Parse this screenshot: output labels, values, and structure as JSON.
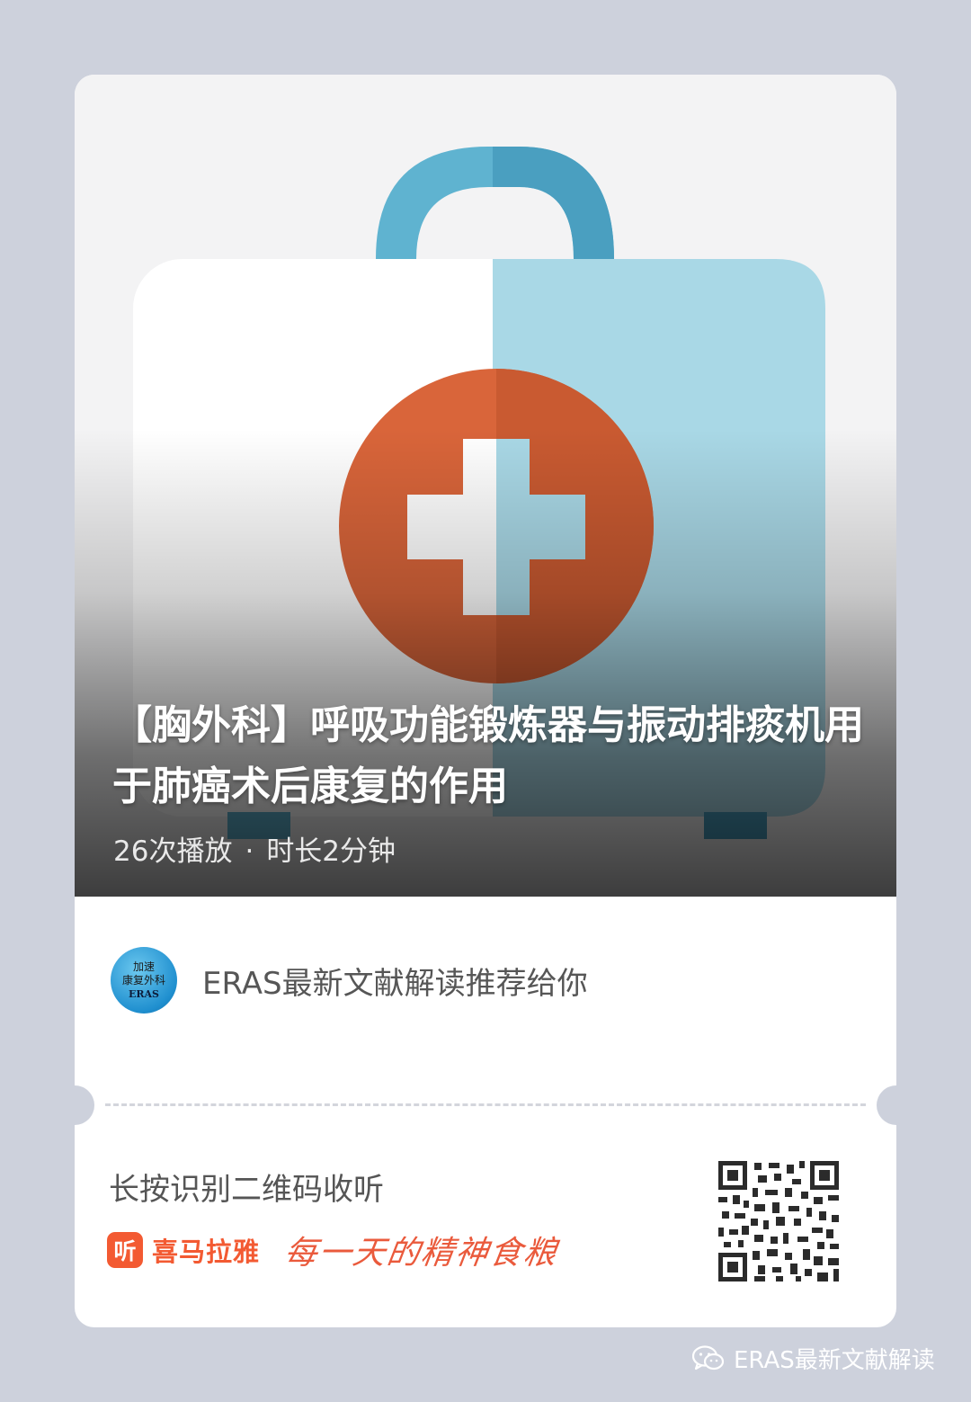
{
  "episode": {
    "title": "【胸外科】呼吸功能锻炼器与振动排痰机用于肺癌术后康复的作用",
    "plays": "26次播放",
    "separator": "·",
    "duration": "时长2分钟"
  },
  "author": {
    "avatar_lines": [
      "加速",
      "康复外科",
      "ERAS"
    ],
    "recommend_text": "ERAS最新文献解读推荐给你"
  },
  "footer": {
    "scan_text": "长按识别二维码收听",
    "brand_icon_char": "听",
    "brand_name": "喜马拉雅",
    "slogan": "每一天的精神食粮"
  },
  "watermark": {
    "text": "ERAS最新文献解读"
  },
  "colors": {
    "background": "#cdd1dc",
    "brand": "#f35a32",
    "kit_blue": "#a9d8e6",
    "cross_orange": "#d9653a"
  },
  "icons": {
    "cover": "medical-kit-icon",
    "brand": "ximalaya-logo-icon",
    "watermark": "wechat-icon",
    "qr": "qr-code"
  }
}
